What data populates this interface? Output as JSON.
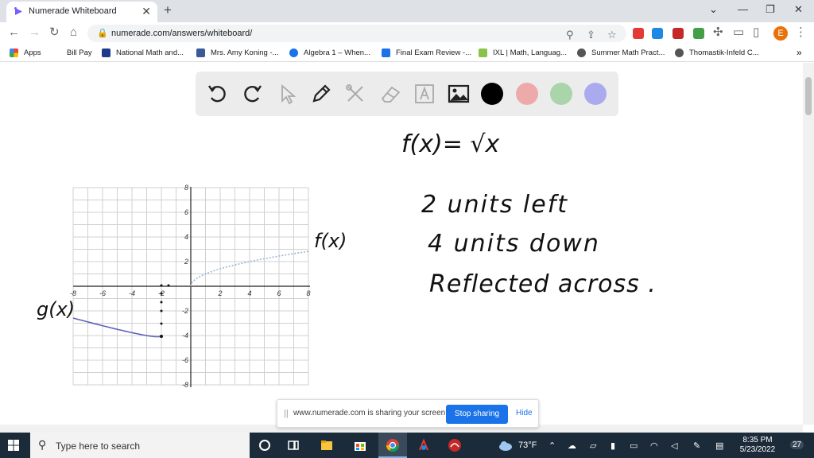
{
  "browser": {
    "tab_title": "Numerade Whiteboard",
    "tab_close": "✕",
    "new_tab": "+",
    "url": "numerade.com/answers/whiteboard/",
    "avatar_letter": "E",
    "window_controls": [
      "⌄",
      "—",
      "❐",
      "✕"
    ]
  },
  "bookmarks": [
    {
      "label": "Apps",
      "color": "#4285f4"
    },
    {
      "label": "Bill Pay",
      "color": "#ffffff"
    },
    {
      "label": "National Math and...",
      "color": "#1e3a8a"
    },
    {
      "label": "Mrs. Amy Koning -...",
      "color": "#3b5998"
    },
    {
      "label": "Algebra 1 – When...",
      "color": "#1a73e8"
    },
    {
      "label": "Final Exam Review -...",
      "color": "#1a73e8"
    },
    {
      "label": "IXL | Math, Languag...",
      "color": "#8bc34a"
    },
    {
      "label": "Summer Math Pract...",
      "color": "#555555"
    },
    {
      "label": "Thomastik-Infeld C...",
      "color": "#555555"
    }
  ],
  "bookmarks_overflow": "»",
  "toolbar": {
    "tools": [
      "undo-icon",
      "redo-icon",
      "pointer-icon",
      "pen-icon",
      "tools-icon",
      "eraser-icon",
      "text-icon",
      "image-icon"
    ],
    "swatches": [
      "#000000",
      "#eeaaaa",
      "#aad4aa",
      "#aaaaee"
    ]
  },
  "graph": {
    "x_ticks": [
      "-8",
      "-6",
      "-4",
      "-2",
      "2",
      "4",
      "6",
      "8"
    ],
    "y_ticks": [
      "8",
      "6",
      "4",
      "2",
      "-2",
      "-4",
      "-6",
      "-8"
    ]
  },
  "handwriting": {
    "formula": "f(x)= √x",
    "line1": "2 units left",
    "line2": "4 units down",
    "line3": "Reflected across .",
    "f_label": "f(x)",
    "g_label": "g(x)"
  },
  "share_banner": {
    "grip": "||",
    "message": "www.numerade.com is sharing your screen.",
    "stop_label": "Stop sharing",
    "hide_label": "Hide"
  },
  "taskbar": {
    "search_placeholder": "Type here to search",
    "weather": "73°F",
    "time": "8:35 PM",
    "date": "5/23/2022",
    "notifications": "27"
  }
}
